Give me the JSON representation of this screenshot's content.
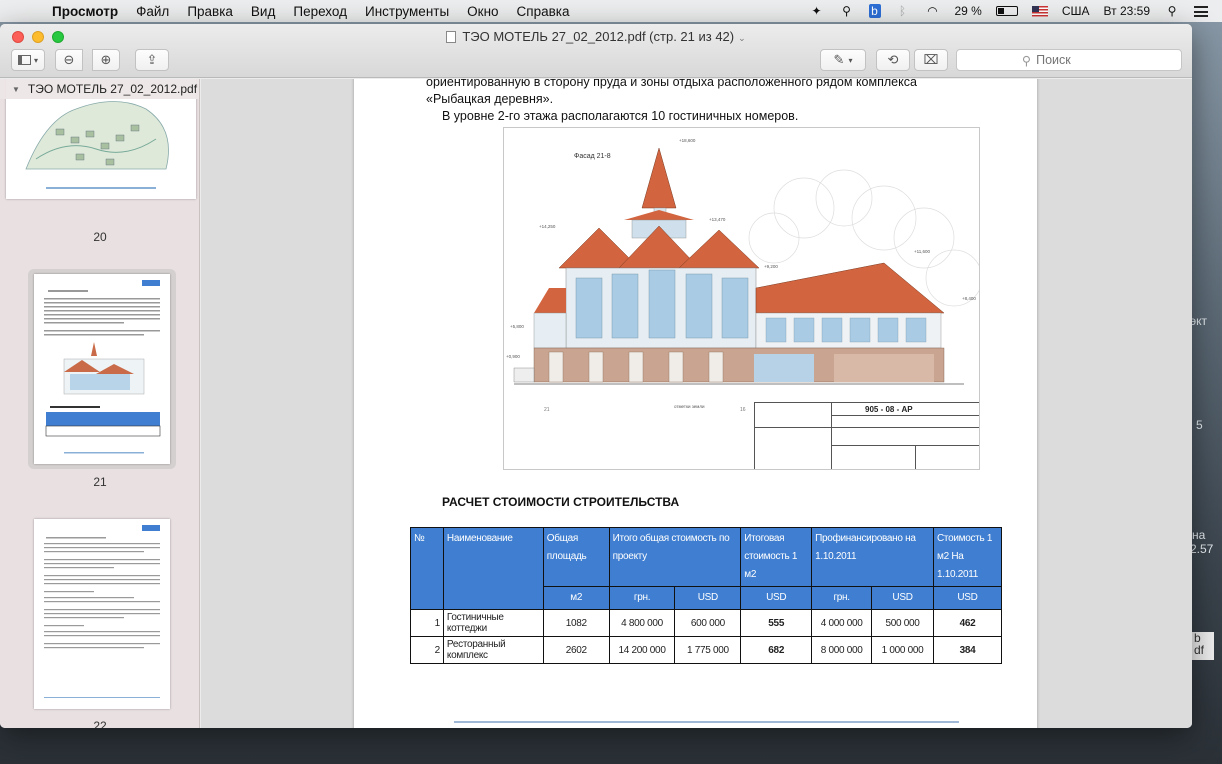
{
  "menubar": {
    "app_name": "Просмотр",
    "items": [
      "Файл",
      "Правка",
      "Вид",
      "Переход",
      "Инструменты",
      "Окно",
      "Справка"
    ],
    "battery_percent": "29 %",
    "battery_level": 0.29,
    "input_source": "США",
    "clock": "Вт 23:59"
  },
  "window": {
    "title": "ТЭО  МОТЕЛЬ 27_02_2012.pdf (стр. 21 из 42)",
    "search_placeholder": "Поиск"
  },
  "sidebar": {
    "document_name": "ТЭО  МОТЕЛЬ 27_02_2012.pdf",
    "pages": [
      {
        "number": "20"
      },
      {
        "number": "21",
        "selected": true
      },
      {
        "number": "22"
      }
    ]
  },
  "page": {
    "text_line1": "ориентированную  в  сторону  пруда  и  зоны  отдыха  расположенного  рядом  комплекса",
    "text_line2": "«Рыбацкая деревня».",
    "text_line3": "В уровне 2-го этажа располагаются 10 гостиничных номеров.",
    "drawing": {
      "label_facade": "Фасад 21-8",
      "stamp_code": "905 - 08 - АР"
    },
    "section_title": "РАСЧЕТ СТОИМОСТИ СТРОИТЕЛЬСТВА",
    "table": {
      "headers": {
        "num": "№",
        "name": "Наименование",
        "area": "Общая площадь",
        "total_cost": "Итого общая стоимость по проекту",
        "cost_m2": "Итоговая стоимость 1 м2",
        "financed": "Профинансировано на 1.10.2011",
        "cost_m2_date": "Стоимость 1 м2 На 1.10.2011"
      },
      "units": {
        "area": "м2",
        "total_uah": "грн.",
        "total_usd": "USD",
        "cost_m2": "USD",
        "fin_uah": "грн.",
        "fin_usd": "USD",
        "cost_m2_date": "USD"
      },
      "rows": [
        {
          "num": "1",
          "name": "Гостиничные коттеджи",
          "area": "1082",
          "total_uah": "4 800 000",
          "total_usd": "600 000",
          "cost_m2": "555",
          "fin_uah": "4 000 000",
          "fin_usd": "500 000",
          "cost_m2_date": "462"
        },
        {
          "num": "2",
          "name": "Ресторанный комплекс",
          "area": "2602",
          "total_uah": "14 200 000",
          "total_usd": "1 775 000",
          "cost_m2": "682",
          "fin_uah": "8 000 000",
          "fin_usd": "1 000 000",
          "cost_m2_date": "384"
        }
      ]
    }
  },
  "desktop": {
    "fragments": [
      "экт",
      "5",
      "на",
      "2.57",
      "b",
      "df"
    ]
  }
}
